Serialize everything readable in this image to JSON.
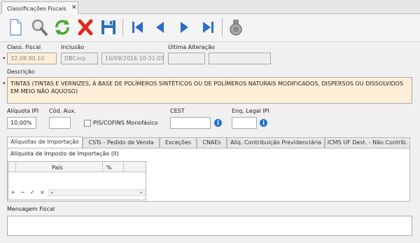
{
  "tab": {
    "title": "Classificações Fiscais",
    "close": "✕"
  },
  "toolbar": {
    "buttons": [
      "new-document",
      "search",
      "refresh",
      "delete",
      "save",
      "first",
      "previous",
      "next",
      "last",
      "cancel"
    ]
  },
  "fields": {
    "class_fiscal": {
      "label": "Class. Fiscal",
      "value": "32.08.90.10"
    },
    "inclusao": {
      "label": "Inclusão",
      "user": "DBCorp",
      "datetime": "16/09/2016 10:31:07"
    },
    "ultima_alteracao": {
      "label": "Última Alteração",
      "user": "",
      "datetime": ""
    },
    "descricao": {
      "label": "Descrição",
      "value": "TINTAS (TINTAS E VERNIZES, À BASE DE POLÍMEROS SINTÉTICOS OU DE POLÍMEROS NATURAIS MODIFICADOS, DISPERSOS OU DISSOLVIDOS EM MEIO NÃO AQUOSO)"
    },
    "aliquota_ipi": {
      "label": "Alíquota IPI",
      "value": "10,00%"
    },
    "cod_aux": {
      "label": "Cód. Aux.",
      "value": ""
    },
    "pis_cofins": {
      "label": "PIS/COFINS Monofásico",
      "checked": false
    },
    "cest": {
      "label": "CEST",
      "value": ""
    },
    "enq_legal_ipi": {
      "label": "Enq. Legal IPI",
      "value": ""
    },
    "mensagem_fiscal": {
      "label": "Mensagem Fiscal",
      "value": ""
    }
  },
  "subtabs": [
    {
      "label": "Alíquotas de Importação",
      "active": true
    },
    {
      "label": "CSTs - Pedido de Venda",
      "active": false
    },
    {
      "label": "Exceções",
      "active": false
    },
    {
      "label": "CNAEs",
      "active": false
    },
    {
      "label": "Alíq. Contribuição Previdenciária",
      "active": false
    },
    {
      "label": "ICMS UF Dest. - Não Contrib.",
      "active": false
    }
  ],
  "import_panel": {
    "title": "Alíquota de Imposto de Importação (II)",
    "columns": [
      "País",
      "%"
    ],
    "rows": [],
    "nav": {
      "add": "+",
      "remove": "−",
      "confirm": "✓",
      "cancel": "×",
      "prev": "◂",
      "next": "▸"
    }
  },
  "colors": {
    "required_bg": "#fdeed7",
    "readonly_bg": "#eeeeee",
    "required_marker": "#d00000",
    "info_blue": "#1f73c9"
  }
}
